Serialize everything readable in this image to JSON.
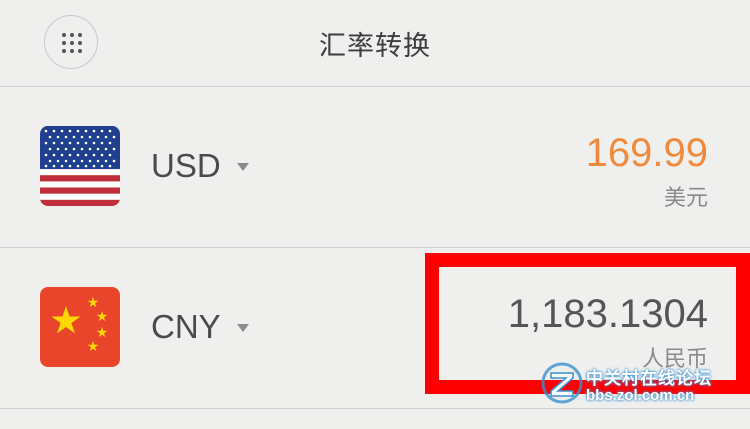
{
  "header": {
    "title": "汇率转换",
    "menu_icon": "grid-dots-icon"
  },
  "currencies": [
    {
      "code": "USD",
      "amount": "169.99",
      "name": "美元",
      "flag": "us-flag-icon",
      "amount_color": "#f08a3c"
    },
    {
      "code": "CNY",
      "amount": "1,183.1304",
      "name": "人民币",
      "flag": "cn-flag-icon",
      "amount_color": "#555555"
    }
  ],
  "highlight_color": "#ff0000",
  "watermark": {
    "text": "中关村在线论坛",
    "url": "bbs.zol.com.cn"
  }
}
